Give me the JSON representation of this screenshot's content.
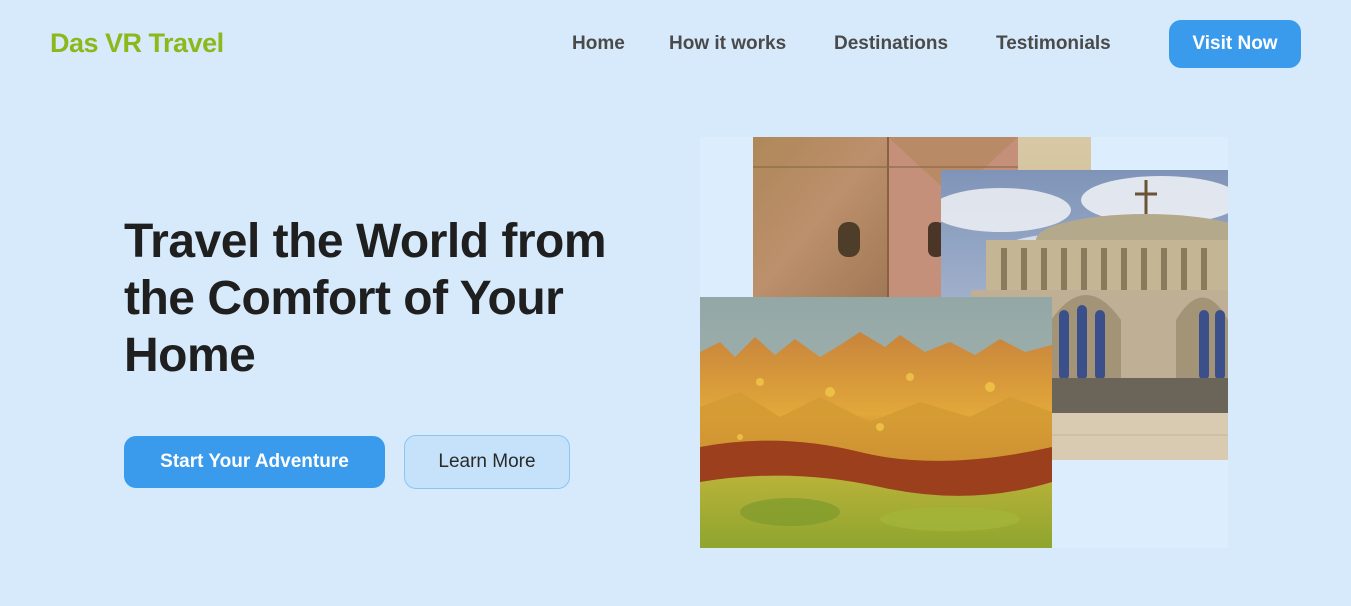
{
  "header": {
    "brand": "Das VR Travel",
    "nav": [
      "Home",
      "How it works",
      "Destinations",
      "Testimonials"
    ],
    "cta": "Visit Now"
  },
  "hero": {
    "title": "Travel the World from the Comfort of Your Home",
    "primary_button": "Start Your Adventure",
    "secondary_button": "Learn More"
  },
  "colors": {
    "background": "#d6eafb",
    "brand": "#8db81b",
    "accent": "#3a9bec",
    "text": "#1f1f1f",
    "nav_text": "#4a4a4a"
  }
}
